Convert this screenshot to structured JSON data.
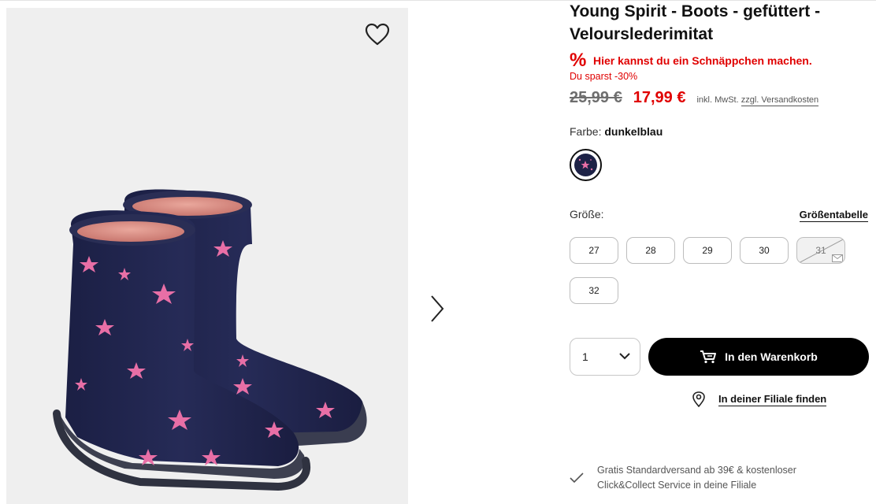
{
  "product": {
    "title": "Young Spirit - Boots - gefüttert - Velourslederimitat",
    "deal_icon": "%",
    "deal_text": "Hier kannst du ein Schnäppchen machen.",
    "save_text": "Du sparst -30%",
    "old_price": "25,99 €",
    "new_price": "17,99 €",
    "tax_prefix": "inkl. MwSt.",
    "tax_link": "zzgl. Versandkosten"
  },
  "color": {
    "label": "Farbe:",
    "value": "dunkelblau",
    "swatch_color": "#1d2246"
  },
  "size": {
    "label": "Größe:",
    "chart_link": "Größentabelle",
    "options": [
      {
        "label": "27",
        "available": true
      },
      {
        "label": "28",
        "available": true
      },
      {
        "label": "29",
        "available": true
      },
      {
        "label": "30",
        "available": true
      },
      {
        "label": "31",
        "available": false
      },
      {
        "label": "32",
        "available": true
      }
    ]
  },
  "purchase": {
    "quantity": "1",
    "cart_button": "In den Warenkorb",
    "store_link": "In deiner Filiale finden"
  },
  "shipping": {
    "text": "Gratis Standardversand ab 39€ & kostenloser Click&Collect Service in deine Filiale"
  },
  "icons": {
    "wishlist": "heart-icon",
    "next": "chevron-right-icon",
    "deal": "percent-icon",
    "unavailable": "mail-icon",
    "quantity": "chevron-down-icon",
    "cart": "cart-icon",
    "store": "location-pin-icon",
    "shipping": "check-icon"
  },
  "colors": {
    "accent": "#e00000",
    "button": "#000000",
    "gallery_bg": "#efefef"
  }
}
